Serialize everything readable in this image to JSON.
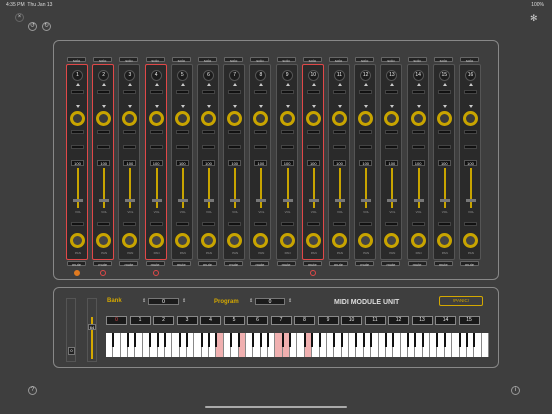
{
  "status": {
    "time": "4:35 PM",
    "date": "Thu Jan 13",
    "battery": "100%"
  },
  "module": {
    "title": "MIDI MODULE UNIT",
    "panic_label": "!PANIC!",
    "bank_label": "Bank",
    "bank_value": "0",
    "program_label": "Program",
    "program_value": "0",
    "volume_value": "64",
    "left_slider_value": "0"
  },
  "strip_labels": {
    "solo": "solo",
    "mute": "mute",
    "vol": "VOL",
    "pan": "PAN"
  },
  "channels": [
    {
      "num": "1",
      "vol": "100",
      "pan": "64",
      "led": "on",
      "sel": true
    },
    {
      "num": "2",
      "vol": "100",
      "pan": "64",
      "led": "off",
      "sel": true
    },
    {
      "num": "3",
      "vol": "100",
      "pan": "64",
      "led": "",
      "sel": false
    },
    {
      "num": "4",
      "vol": "100",
      "pan": "64",
      "led": "off",
      "sel": true
    },
    {
      "num": "5",
      "vol": "100",
      "pan": "64",
      "led": "",
      "sel": false
    },
    {
      "num": "6",
      "vol": "100",
      "pan": "64",
      "led": "",
      "sel": false
    },
    {
      "num": "7",
      "vol": "100",
      "pan": "64",
      "led": "",
      "sel": false
    },
    {
      "num": "8",
      "vol": "100",
      "pan": "64",
      "led": "",
      "sel": false
    },
    {
      "num": "9",
      "vol": "100",
      "pan": "64",
      "led": "",
      "sel": false
    },
    {
      "num": "10",
      "vol": "100",
      "pan": "64",
      "led": "off",
      "sel": true
    },
    {
      "num": "11",
      "vol": "100",
      "pan": "64",
      "led": "",
      "sel": false
    },
    {
      "num": "12",
      "vol": "100",
      "pan": "64",
      "led": "",
      "sel": false
    },
    {
      "num": "13",
      "vol": "100",
      "pan": "64",
      "led": "",
      "sel": false
    },
    {
      "num": "14",
      "vol": "100",
      "pan": "64",
      "led": "",
      "sel": false
    },
    {
      "num": "15",
      "vol": "100",
      "pan": "64",
      "led": "",
      "sel": false
    },
    {
      "num": "16",
      "vol": "100",
      "pan": "64",
      "led": "",
      "sel": false
    }
  ],
  "channel_buttons": [
    "0",
    "1",
    "2",
    "3",
    "4",
    "5",
    "6",
    "7",
    "8",
    "9",
    "10",
    "11",
    "12",
    "13",
    "14",
    "15"
  ],
  "colors": {
    "accent": "#d4a800",
    "select": "#e04848",
    "led_on": "#e07a20"
  },
  "icons": {
    "help": "question-icon",
    "info": "info-icon",
    "settings": "gear-icon"
  }
}
